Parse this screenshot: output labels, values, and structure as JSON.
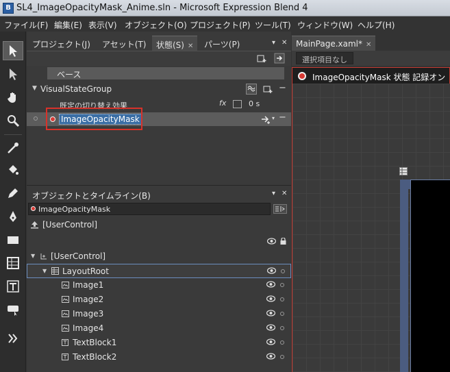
{
  "window": {
    "title": "SL4_ImageOpacityMask_Anime.sln - Microsoft Expression Blend 4"
  },
  "menu": [
    "ファイル(F)",
    "編集(E)",
    "表示(V)",
    "オブジェクト(O)",
    "プロジェクト(P)",
    "ツール(T)",
    "ウィンドウ(W)",
    "ヘルプ(H)"
  ],
  "tabs": [
    {
      "label": "プロジェクト(J)"
    },
    {
      "label": "アセット(T)"
    },
    {
      "label": "状態(S)"
    },
    {
      "label": "パーツ(P)"
    }
  ],
  "states": {
    "base_label": "ベース",
    "group_name": "VisualStateGroup",
    "transition_label": "既定の切り替え効果",
    "transition_duration": "0 s",
    "state_name": "ImageOpacityMask"
  },
  "objects_panel": {
    "title": "オブジェクトとタイムライン(B)",
    "scope": "ImageOpacityMask",
    "root_label": "[UserControl]",
    "tree": [
      {
        "label": "[UserControl]"
      },
      {
        "label": "LayoutRoot"
      },
      {
        "label": "Image1"
      },
      {
        "label": "Image2"
      },
      {
        "label": "Image3"
      },
      {
        "label": "Image4"
      },
      {
        "label": "TextBlock1"
      },
      {
        "label": "TextBlock2"
      }
    ]
  },
  "document": {
    "tab_label": "MainPage.xaml*",
    "breadcrumb": "選択項目なし",
    "recording_text": "ImageOpacityMask 状態 記録オン"
  },
  "colors": {
    "recording_red": "#d83a34",
    "selection_blue": "#3a6ea5",
    "panel_bg": "#3a3a3a"
  }
}
